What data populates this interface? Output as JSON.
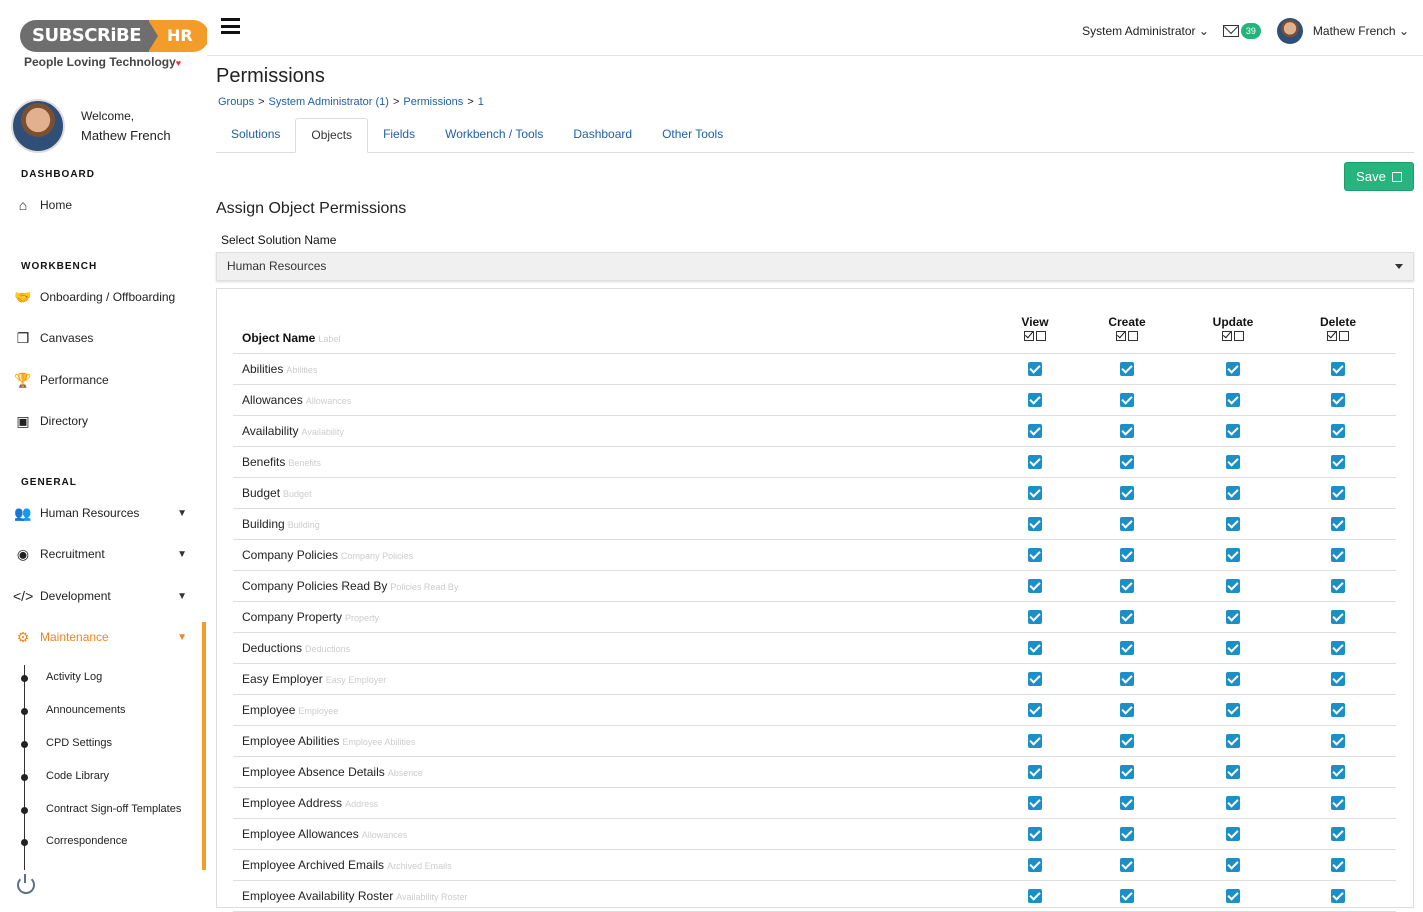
{
  "brand": {
    "left": "SUBSCRiBE",
    "right": "HR",
    "tagline": "People Loving Technology"
  },
  "user": {
    "welcome": "Welcome,",
    "name": "Mathew French",
    "role": "System Administrator",
    "mail_count": "39"
  },
  "sidebar": {
    "sections": {
      "dashboard": "DASHBOARD",
      "workbench": "WORKBENCH",
      "general": "GENERAL"
    },
    "dashboard_items": [
      {
        "label": "Home",
        "icon": "home-icon"
      }
    ],
    "workbench_items": [
      {
        "label": "Onboarding / Offboarding",
        "icon": "handshake-icon"
      },
      {
        "label": "Canvases",
        "icon": "copy-icon"
      },
      {
        "label": "Performance",
        "icon": "trophy-icon"
      },
      {
        "label": "Directory",
        "icon": "contact-book-icon"
      }
    ],
    "general_items": [
      {
        "label": "Human Resources",
        "icon": "users-icon"
      },
      {
        "label": "Recruitment",
        "icon": "target-icon"
      },
      {
        "label": "Development",
        "icon": "code-icon"
      },
      {
        "label": "Maintenance",
        "icon": "cogs-icon"
      }
    ],
    "maintenance_subitems": [
      "Activity Log",
      "Announcements",
      "CPD Settings",
      "Code Library",
      "Contract Sign-off Templates",
      "Correspondence"
    ],
    "accent_color": "#f39c2a"
  },
  "page": {
    "title": "Permissions",
    "breadcrumb": [
      "Groups",
      "System Administrator (1)",
      "Permissions",
      "1"
    ],
    "tabs": [
      "Solutions",
      "Objects",
      "Fields",
      "Workbench / Tools",
      "Dashboard",
      "Other Tools"
    ],
    "active_tab": "Objects",
    "save_label": "Save",
    "section_heading": "Assign Object Permissions",
    "select_label": "Select Solution Name",
    "selected_solution": "Human Resources"
  },
  "table": {
    "name_header": "Object Name",
    "name_header_sub": "Label",
    "perm_columns": [
      "View",
      "Create",
      "Update",
      "Delete"
    ],
    "rows": [
      {
        "name": "Abilities",
        "label": "Abilities"
      },
      {
        "name": "Allowances",
        "label": "Allowances"
      },
      {
        "name": "Availability",
        "label": "Availability"
      },
      {
        "name": "Benefits",
        "label": "Benefits"
      },
      {
        "name": "Budget",
        "label": "Budget"
      },
      {
        "name": "Building",
        "label": "Building"
      },
      {
        "name": "Company Policies",
        "label": "Company Policies"
      },
      {
        "name": "Company Policies Read By",
        "label": "Policies Read By"
      },
      {
        "name": "Company Property",
        "label": "Property"
      },
      {
        "name": "Deductions",
        "label": "Deductions"
      },
      {
        "name": "Easy Employer",
        "label": "Easy Employer"
      },
      {
        "name": "Employee",
        "label": "Employee"
      },
      {
        "name": "Employee Abilities",
        "label": "Employee Abilities"
      },
      {
        "name": "Employee Absence Details",
        "label": "Absence"
      },
      {
        "name": "Employee Address",
        "label": "Address"
      },
      {
        "name": "Employee Allowances",
        "label": "Allowances"
      },
      {
        "name": "Employee Archived Emails",
        "label": "Archived Emails"
      },
      {
        "name": "Employee Availability Roster",
        "label": "Availability Roster"
      }
    ],
    "checkbox_color": "#1b8fc6"
  }
}
